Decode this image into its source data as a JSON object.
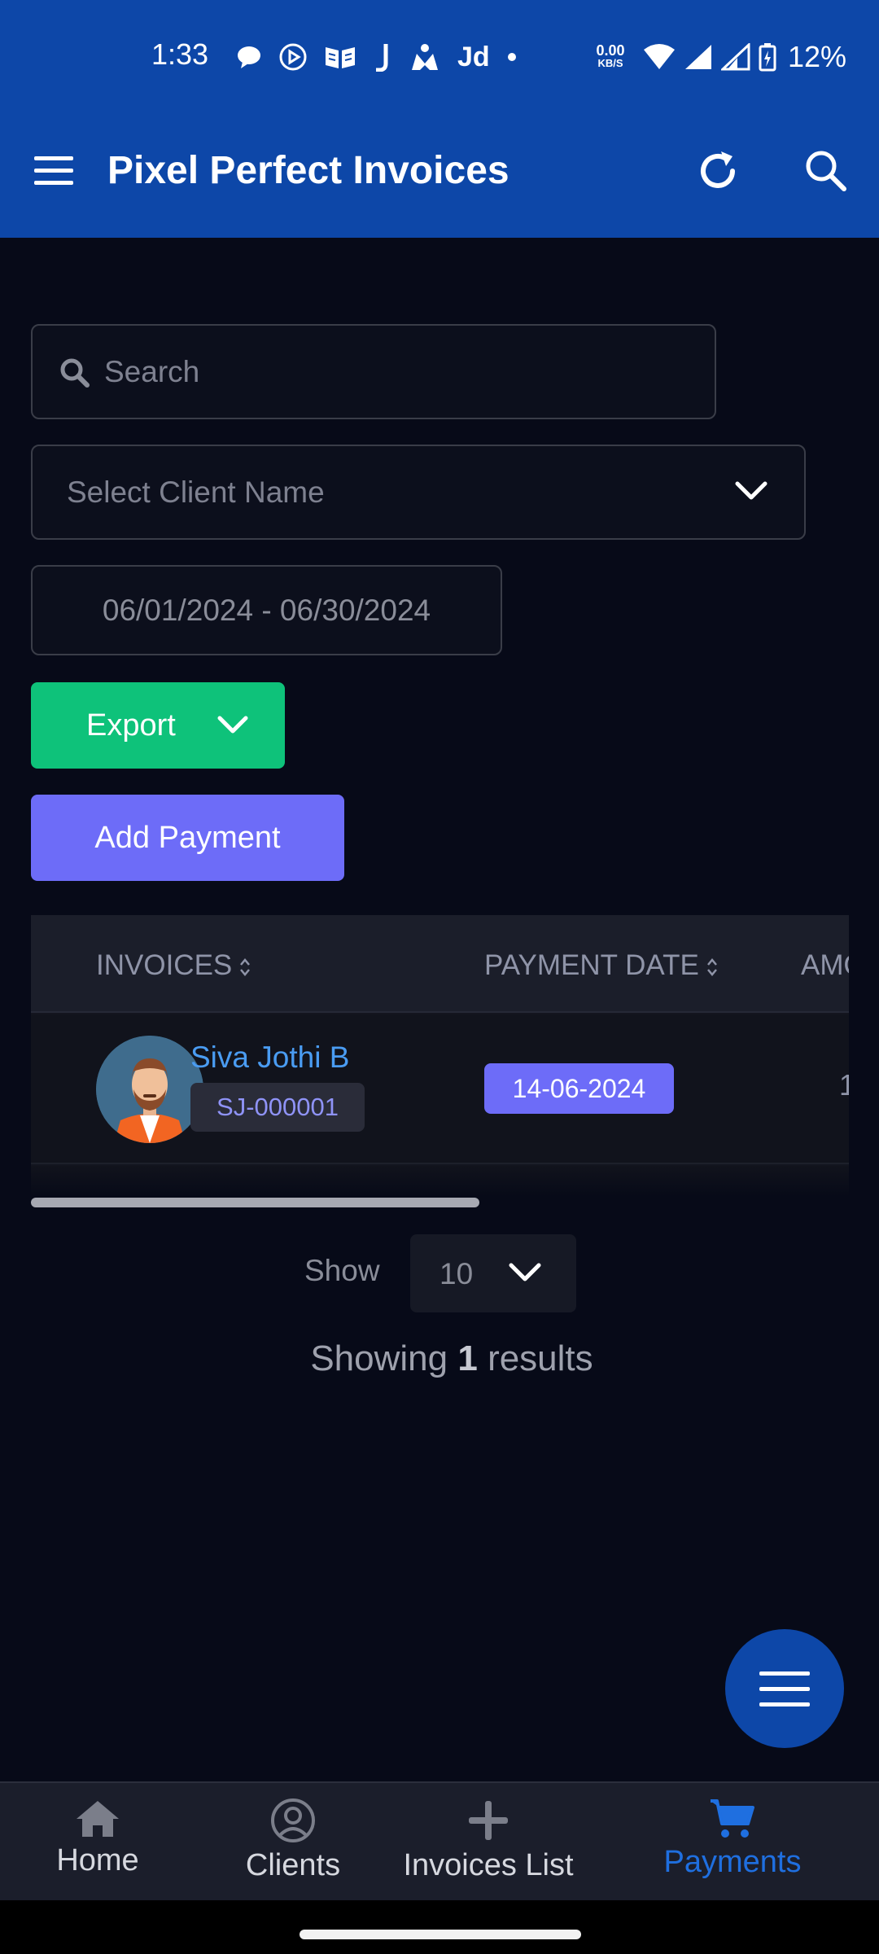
{
  "status_bar": {
    "time": "1:33",
    "net_speed_value": "0.00",
    "net_speed_unit": "KB/S",
    "battery_percent": "12%",
    "jd_label": "Jd"
  },
  "app_bar": {
    "title": "Pixel Perfect Invoices"
  },
  "filters": {
    "search_placeholder": "Search",
    "client_select_placeholder": "Select Client Name",
    "date_range": "06/01/2024 - 06/30/2024"
  },
  "actions": {
    "export_label": "Export",
    "add_payment_label": "Add Payment"
  },
  "table": {
    "columns": [
      "INVOICES",
      "PAYMENT DATE",
      "AMO"
    ],
    "rows": [
      {
        "client_name": "Siva Jothi B",
        "invoice_code": "SJ-000001",
        "payment_date": "14-06-2024",
        "amount_partial": "1"
      }
    ]
  },
  "pagination": {
    "show_label": "Show",
    "page_size": "10",
    "results_prefix": "Showing",
    "results_count": "1",
    "results_suffix": "results"
  },
  "bottom_nav": {
    "items": [
      {
        "label": "Home",
        "icon": "home-icon"
      },
      {
        "label": "Clients",
        "icon": "user-circle-icon"
      },
      {
        "label": "Invoices List",
        "icon": "plus-icon"
      },
      {
        "label": "Payments",
        "icon": "cart-icon",
        "active": true
      }
    ]
  },
  "colors": {
    "app_bar": "#0d47a8",
    "background": "#070a18",
    "export_green": "#0ec27a",
    "primary_purple": "#6d6cf8",
    "link_blue": "#4a9cf2",
    "active_nav": "#1f6fe0"
  }
}
